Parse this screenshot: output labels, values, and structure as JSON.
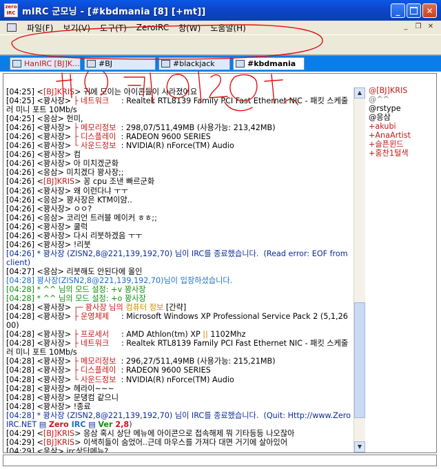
{
  "window": {
    "app_icon_text": "zero IRC",
    "title": "mIRC 군모닝 - [#kbdmania [8] [+mt]]"
  },
  "menu": [
    {
      "label": "파일(F)"
    },
    {
      "label": "보기(V)"
    },
    {
      "label": "도구(T)"
    },
    {
      "label": "ZeroIRC"
    },
    {
      "label": "창(W)"
    },
    {
      "label": "도움말(H)"
    }
  ],
  "switchbar": [
    {
      "label": "HanIRC [BJ]K...",
      "active": false
    },
    {
      "label": "#BJ",
      "active": false
    },
    {
      "label": "#blackjack",
      "active": false
    },
    {
      "label": "#kbdmania",
      "active": true
    }
  ],
  "chat_lines": [
    {
      "parts": [
        {
          "t": "[04:25] <"
        },
        {
          "t": "[BJ]KRIS",
          "c": "red"
        },
        {
          "t": "> 귀에 모이는 아이콘들이 사라졌어요"
        }
      ]
    },
    {
      "parts": [
        {
          "t": "[04:25] <꽝사장> "
        },
        {
          "t": "├ 네트워크",
          "c": "red"
        },
        {
          "t": "     : Realtek RTL8139 Family PCI Fast Ethernet NIC - 패킷 스케줄러 미니 포트 10Mb/s"
        }
      ]
    },
    {
      "parts": [
        {
          "t": "[04:25] <응삼> 헌미,"
        }
      ]
    },
    {
      "parts": [
        {
          "t": "[04:26] <꽝사장> "
        },
        {
          "t": "├ 메모리정보",
          "c": "red"
        },
        {
          "t": "  : 298,07/511,49MB (사용가능: 213,42MB)"
        }
      ]
    },
    {
      "parts": [
        {
          "t": "[04:26] <꽝사장> "
        },
        {
          "t": "├ 디스플레이",
          "c": "red"
        },
        {
          "t": "  : RADEON 9600 SERIES"
        }
      ]
    },
    {
      "parts": [
        {
          "t": "[04:26] <꽝사장> "
        },
        {
          "t": "└ 사운드정보",
          "c": "red"
        },
        {
          "t": "  : NVIDIA(R) nForce(TM) Audio"
        }
      ]
    },
    {
      "parts": [
        {
          "t": "[04:26] <꽝사장> 컴"
        }
      ]
    },
    {
      "parts": [
        {
          "t": "[04:26] <꽝사장> 아 미치겠군화"
        }
      ]
    },
    {
      "parts": [
        {
          "t": "[04:26] <응삼> 미치겠다 꽝사장;;"
        }
      ]
    },
    {
      "parts": [
        {
          "t": "[04:26] <"
        },
        {
          "t": "[BJ]KRIS",
          "c": "red"
        },
        {
          "t": "> 꽁 cpu 조낸 빠르군화"
        }
      ]
    },
    {
      "parts": [
        {
          "t": "[04:26] <꽝사장> 왜 이런다냐 ㅜㅜ"
        }
      ]
    },
    {
      "parts": [
        {
          "t": "[04:26] <응삼> 꽝사장은 KTM이얌.."
        }
      ]
    },
    {
      "parts": [
        {
          "t": "[04:26] <꽝사장> ㅇㅇ?"
        }
      ]
    },
    {
      "parts": [
        {
          "t": "[04:26] <응삼> 코리언 트러블 메이커 ㅎㅎ;;"
        }
      ]
    },
    {
      "parts": [
        {
          "t": "[04:26] <꽝사장> 쿨럭"
        }
      ]
    },
    {
      "parts": [
        {
          "t": "[04:26] <꽝사장> 다시 리붓하겠음 ㅜㅜ"
        }
      ]
    },
    {
      "parts": [
        {
          "t": "[04:26] <꽝사장> !리붓"
        }
      ]
    },
    {
      "parts": [
        {
          "t": "[04:26] * 꽝사장 (ZISN2,8@221,139,192,70) 님이 IRC를 종료했습니다.  (Read error: EOF from client)",
          "c": "navy"
        }
      ]
    },
    {
      "parts": [
        {
          "t": "[04:27] <응삼> 리붓해도 안된다에 올인"
        }
      ]
    },
    {
      "parts": [
        {
          "t": "[04:28] 꽝사장(ZISN2,8@221,139,192,70)님이 입장하셨습니다.",
          "c": "blue"
        }
      ]
    },
    {
      "parts": [
        {
          "t": "[04:28] * ^^ 님의 모드 설정: +v 꽝사장",
          "c": "green"
        }
      ]
    },
    {
      "parts": [
        {
          "t": "[04:28] * ^^ 님의 모드 설정: +o 꽝사장",
          "c": "green"
        }
      ]
    },
    {
      "parts": [
        {
          "t": "[04:28] <꽝사장> "
        },
        {
          "t": "┌─ 꽝사장 님의 ",
          "c": "red"
        },
        {
          "t": "컴퓨터 정보",
          "c": "orange"
        },
        {
          "t": " [간략]"
        }
      ]
    },
    {
      "parts": [
        {
          "t": "[04:28] <꽝사장> "
        },
        {
          "t": "├ 운영체제",
          "c": "red"
        },
        {
          "t": "     : Microsoft Windows XP Professional Service Pack 2 (5,1,2600)"
        }
      ]
    },
    {
      "parts": [
        {
          "t": "[04:28] <꽝사장> "
        },
        {
          "t": "├ 프로세서",
          "c": "red"
        },
        {
          "t": "     : AMD Athlon(tm) XP "
        },
        {
          "t": "||",
          "c": "orange"
        },
        {
          "t": " 1102Mhz"
        }
      ]
    },
    {
      "parts": [
        {
          "t": "[04:28] <꽝사장> "
        },
        {
          "t": "├ 네트워크",
          "c": "red"
        },
        {
          "t": "     : Realtek RTL8139 Family PCI Fast Ethernet NIC - 패킷 스케줄러 미니 포트 10Mb/s"
        }
      ]
    },
    {
      "parts": [
        {
          "t": "[04:28] <꽝사장> "
        },
        {
          "t": "├ 메모리정보",
          "c": "red"
        },
        {
          "t": "  : 296,27/511,49MB (사용가능: 215,21MB)"
        }
      ]
    },
    {
      "parts": [
        {
          "t": "[04:28] <꽝사장> "
        },
        {
          "t": "├ 디스플레이",
          "c": "red"
        },
        {
          "t": "  : RADEON 9600 SERIES"
        }
      ]
    },
    {
      "parts": [
        {
          "t": "[04:28] <꽝사장> "
        },
        {
          "t": "└ 사운드정보",
          "c": "red"
        },
        {
          "t": "  : NVIDIA(R) nForce(TM) Audio"
        }
      ]
    },
    {
      "parts": [
        {
          "t": "[04:28] <꽝사장> 헤라이~~~"
        }
      ]
    },
    {
      "parts": [
        {
          "t": "[04:28] <꽝사장> 문댕컴 같으니"
        }
      ]
    },
    {
      "parts": [
        {
          "t": "[04:28] <꽝사장> !종료"
        }
      ]
    },
    {
      "parts": [
        {
          "t": "[04:28] * 꽝사장 (ZISN2,8@221,139,192,70) 님이 IRC를 종료했습니다.  (Quit: Http://www.ZeroIRC.NET ▤ ",
          "c": "navy"
        },
        {
          "t": "Zero",
          "c": "red",
          "b": true
        },
        {
          "t": " IRC",
          "c": "blue",
          "b": true
        },
        {
          "t": " ▤ ",
          "c": "navy"
        },
        {
          "t": "Ver",
          "c": "green",
          "b": true
        },
        {
          "t": " 2,8",
          "c": "red",
          "b": true
        },
        {
          "t": ")",
          "c": "navy"
        }
      ]
    },
    {
      "parts": [
        {
          "t": "[04:29] <"
        },
        {
          "t": "[BJ]KRIS",
          "c": "red"
        },
        {
          "t": "> 응삼 혹시 상단 메뉴에 아이콘으로 접속해제 뭐 기타등등 나오잖아"
        }
      ]
    },
    {
      "parts": [
        {
          "t": "[04:29] <"
        },
        {
          "t": "[BJ]KRIS",
          "c": "red"
        },
        {
          "t": "> 이색히들이 숨었어..근데 마우스를 가져다 대면 거기에 살아있어"
        }
      ]
    },
    {
      "parts": [
        {
          "t": "[04:29] <응삼> irc상단메뉴?"
        }
      ]
    }
  ],
  "nicklist": [
    {
      "label": "@[BJ]KRIS",
      "c": "red"
    },
    {
      "label": "@^^",
      "c": "gray"
    },
    {
      "label": "@rstype",
      "c": ""
    },
    {
      "label": "@응삼",
      "c": ""
    },
    {
      "label": "+akubi",
      "c": "red"
    },
    {
      "label": "+AnaArtist",
      "c": "red"
    },
    {
      "label": "+슬픈윈드",
      "c": "red"
    },
    {
      "label": "+홍찬1털색",
      "c": "red"
    }
  ],
  "editbox": {
    "value": ""
  },
  "scrollbar": {
    "up_glyph": "▲",
    "down_glyph": "▼"
  },
  "colors": {
    "red": "#c81818",
    "green": "#108f10",
    "blue": "#1a6fc4",
    "orange": "#d08800",
    "gray": "#7a7a7a",
    "navy": "#0a2a9a",
    "switchbar": "#0a7ee8",
    "titlebar": "#0d46c8"
  }
}
